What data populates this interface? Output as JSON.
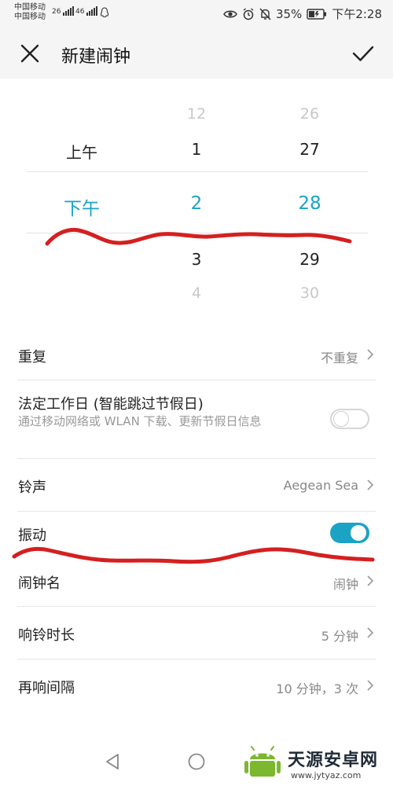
{
  "status_bar": {
    "carrier1": "中国移动",
    "carrier2": "中国移动",
    "net1": "26",
    "net2": "46",
    "battery": "35%",
    "time": "下午2:28"
  },
  "header": {
    "title": "新建闹钟"
  },
  "picker": {
    "period": {
      "above": "上午",
      "selected": "下午"
    },
    "hour": {
      "above2": "12",
      "above1": "1",
      "selected": "2",
      "below1": "3",
      "below2": "4"
    },
    "minute": {
      "above2": "26",
      "above1": "27",
      "selected": "28",
      "below1": "29",
      "below2": "30"
    }
  },
  "settings": {
    "repeat": {
      "label": "重复",
      "value": "不重复"
    },
    "workday": {
      "label": "法定工作日 (智能跳过节假日)",
      "sub": "通过移动网络或 WLAN 下载、更新节假日信息",
      "enabled": false
    },
    "ringtone": {
      "label": "铃声",
      "value": "Aegean Sea"
    },
    "vibrate": {
      "label": "振动",
      "enabled": true
    },
    "name": {
      "label": "闹钟名",
      "value": "闹钟"
    },
    "duration": {
      "label": "响铃时长",
      "value": "5 分钟"
    },
    "snooze": {
      "label": "再响间隔",
      "value": "10 分钟，3 次"
    }
  },
  "watermark": {
    "title": "天源安卓网",
    "url": "www.jytyaz.com"
  },
  "colors": {
    "accent": "#1aa3c4",
    "scribble": "#d42020"
  }
}
